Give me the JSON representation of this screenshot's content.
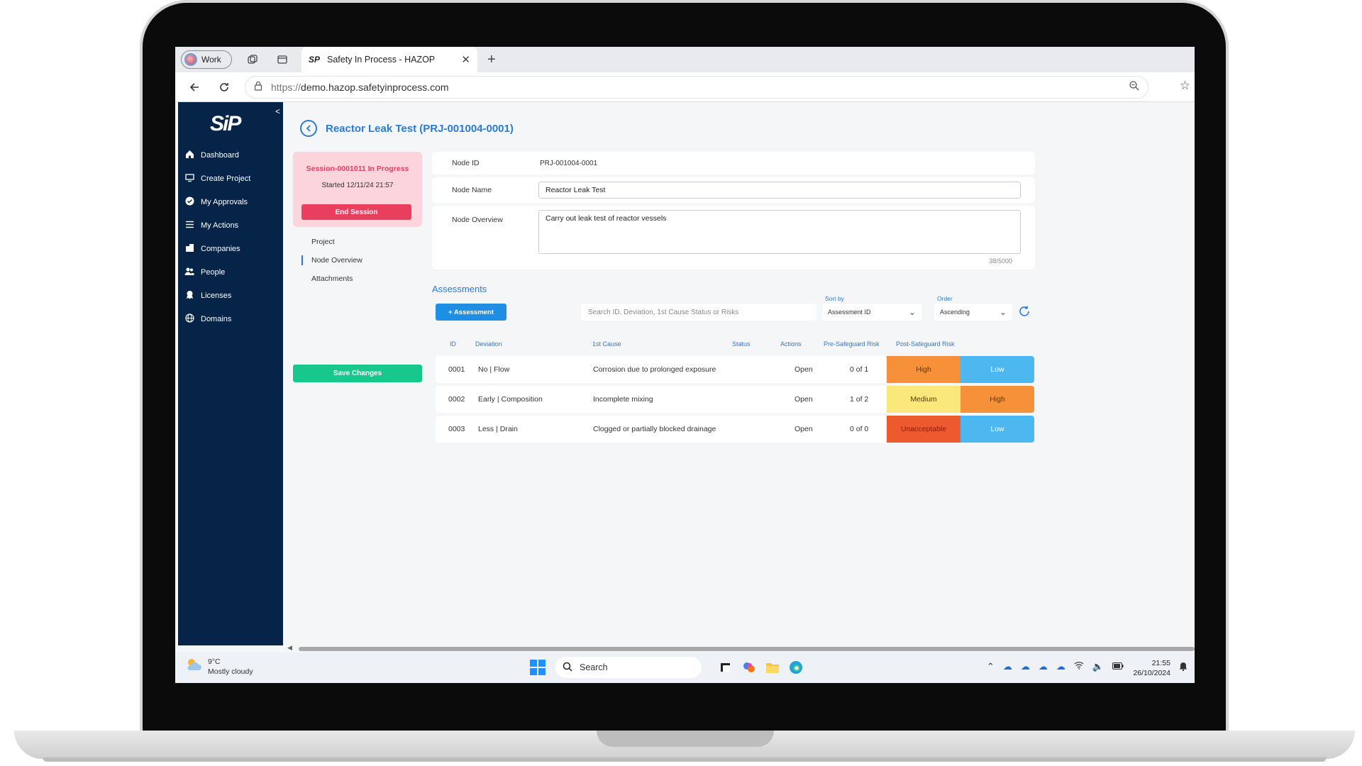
{
  "browser": {
    "profile_label": "Work",
    "tab_favicon": "SP",
    "tab_title": "Safety In Process - HAZOP",
    "tab_close": "✕",
    "new_tab": "+",
    "url_protocol": "https://",
    "url_host": "demo.hazop.safetyinprocess.com"
  },
  "sidebar": {
    "logo": "SiP",
    "collapse": "<",
    "items": [
      {
        "label": "Dashboard",
        "icon": "home-icon"
      },
      {
        "label": "Create Project",
        "icon": "monitor-icon"
      },
      {
        "label": "My Approvals",
        "icon": "check-circle-icon"
      },
      {
        "label": "My Actions",
        "icon": "list-icon"
      },
      {
        "label": "Companies",
        "icon": "building-icon"
      },
      {
        "label": "People",
        "icon": "people-icon"
      },
      {
        "label": "Licenses",
        "icon": "license-icon"
      },
      {
        "label": "Domains",
        "icon": "globe-icon"
      }
    ]
  },
  "page": {
    "title": "Reactor Leak Test (PRJ-001004-0001)"
  },
  "session": {
    "title": "Session-0001011 In Progress",
    "started": "Started 12/11/24 21:57",
    "end_label": "End Session"
  },
  "left_menu": {
    "items": [
      "Project",
      "Node Overview",
      "Attachments"
    ],
    "active": "Node Overview",
    "save_label": "Save Changes"
  },
  "node": {
    "id_label": "Node ID",
    "id_value": "PRJ-001004-0001",
    "name_label": "Node Name",
    "name_value": "Reactor Leak Test",
    "overview_label": "Node Overview",
    "overview_value": "Carry out leak test of reactor vessels",
    "overview_count": "38/5000"
  },
  "assessments": {
    "title": "Assessments",
    "add_label": "+ Assessment",
    "search_placeholder": "Search ID, Deviation, 1st Cause Status or Risks",
    "sort_label": "Sort by",
    "sort_value": "Assessment ID",
    "order_label": "Order",
    "order_value": "Ascending",
    "columns": {
      "id": "ID",
      "deviation": "Deviation",
      "cause": "1st Cause",
      "status": "Status",
      "actions": "Actions",
      "pre": "Pre-Safeguard Risk",
      "post": "Post-Safeguard Risk"
    },
    "rows": [
      {
        "id": "0001",
        "deviation": "No | Flow",
        "cause": "Corrosion due to prolonged exposure",
        "status": "Open",
        "actions": "0 of 1",
        "pre": "High",
        "post": "Low"
      },
      {
        "id": "0002",
        "deviation": "Early | Composition",
        "cause": "Incomplete mixing",
        "status": "Open",
        "actions": "1 of 2",
        "pre": "Medium",
        "post": "High"
      },
      {
        "id": "0003",
        "deviation": "Less | Drain",
        "cause": "Clogged or partially blocked drainage",
        "status": "Open",
        "actions": "0 of 0",
        "pre": "Unacceptable",
        "post": "Low"
      }
    ],
    "risk_colors": {
      "Low": "#4db8f0",
      "Medium": "#fbe87a",
      "High": "#f6913a",
      "Unacceptable": "#ee5a2f"
    }
  },
  "taskbar": {
    "temp": "9°C",
    "weather": "Mostly cloudy",
    "search_label": "Search",
    "time": "21:55",
    "date": "26/10/2024"
  },
  "colors": {
    "sidebar_bg": "#052447",
    "accent": "#2a7bd4",
    "save_green": "#17c88c",
    "end_red": "#ea3e5f",
    "session_bg": "#fbd4dc"
  }
}
